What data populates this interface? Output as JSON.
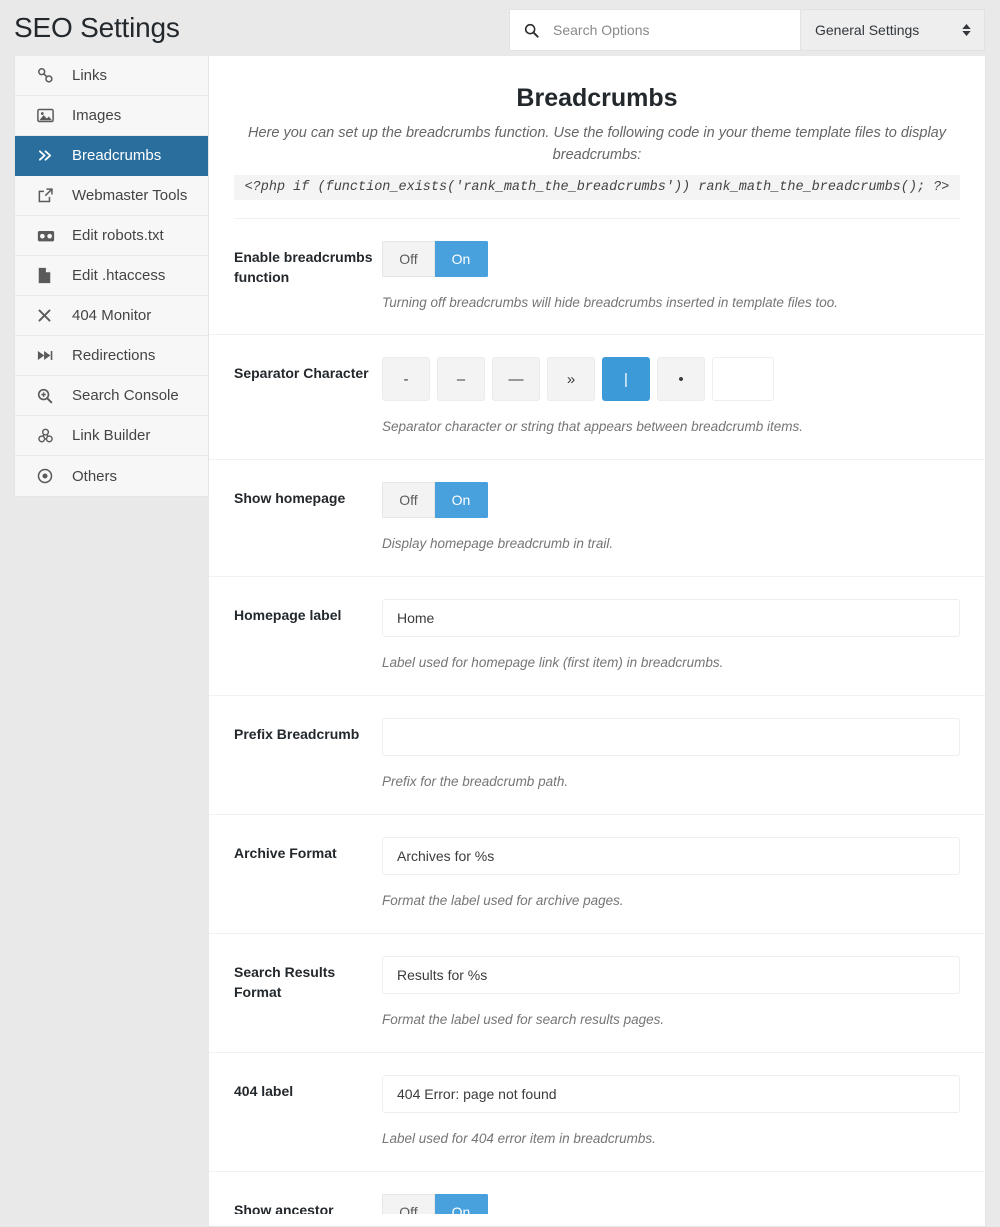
{
  "header": {
    "app_title": "SEO Settings",
    "search": {
      "placeholder": "Search Options",
      "value": "",
      "icon": "search-icon"
    },
    "settings_select": {
      "value": "General Settings",
      "icon": "chevron-up-down-icon"
    }
  },
  "sidebar": {
    "items": [
      {
        "label": "Links",
        "icon": "link-icon",
        "active": false
      },
      {
        "label": "Images",
        "icon": "image-icon",
        "active": false
      },
      {
        "label": "Breadcrumbs",
        "icon": "chevrons-right-icon",
        "active": true
      },
      {
        "label": "Webmaster Tools",
        "icon": "external-link-icon",
        "active": false
      },
      {
        "label": "Edit robots.txt",
        "icon": "robot-icon",
        "active": false
      },
      {
        "label": "Edit .htaccess",
        "icon": "file-icon",
        "active": false
      },
      {
        "label": "404 Monitor",
        "icon": "close-x-icon",
        "active": false
      },
      {
        "label": "Redirections",
        "icon": "fast-forward-icon",
        "active": false
      },
      {
        "label": "Search Console",
        "icon": "magnifier-plus-icon",
        "active": false
      },
      {
        "label": "Link Builder",
        "icon": "link-builder-icon",
        "active": false
      },
      {
        "label": "Others",
        "icon": "target-dot-icon",
        "active": false
      }
    ]
  },
  "panel": {
    "title": "Breadcrumbs",
    "description": "Here you can set up the breadcrumbs function. Use the following code in your theme template files to display breadcrumbs:",
    "code": "<?php if (function_exists('rank_math_the_breadcrumbs')) rank_math_the_breadcrumbs(); ?>"
  },
  "settings": {
    "enable_breadcrumbs": {
      "label": "Enable breadcrumbs function",
      "off_label": "Off",
      "on_label": "On",
      "selected": "On",
      "help": "Turning off breadcrumbs will hide breadcrumbs inserted in template files too."
    },
    "separator": {
      "label": "Separator Character",
      "options": [
        "-",
        "–",
        "—",
        "»",
        "|",
        "•"
      ],
      "selected_index": 4,
      "custom_value": "",
      "custom_placeholder": "",
      "help": "Separator character or string that appears between breadcrumb items."
    },
    "show_homepage": {
      "label": "Show homepage",
      "off_label": "Off",
      "on_label": "On",
      "selected": "On",
      "help": "Display homepage breadcrumb in trail."
    },
    "homepage_label": {
      "label": "Homepage label",
      "value": "Home",
      "placeholder": "",
      "help": "Label used for homepage link (first item) in breadcrumbs."
    },
    "prefix_breadcrumb": {
      "label": "Prefix Breadcrumb",
      "value": "",
      "placeholder": "",
      "help": "Prefix for the breadcrumb path."
    },
    "archive_format": {
      "label": "Archive Format",
      "value": "Archives for %s",
      "placeholder": "",
      "help": "Format the label used for archive pages."
    },
    "search_results_format": {
      "label": "Search Results Format",
      "value": "Results for %s",
      "placeholder": "",
      "help": "Format the label used for search results pages."
    },
    "label_404": {
      "label": "404 label",
      "value": "404 Error: page not found",
      "placeholder": "",
      "help": "Label used for 404 error item in breadcrumbs."
    },
    "show_ancestor": {
      "label": "Show ancestor",
      "off_label": "Off",
      "on_label": "On",
      "selected": "On"
    }
  }
}
